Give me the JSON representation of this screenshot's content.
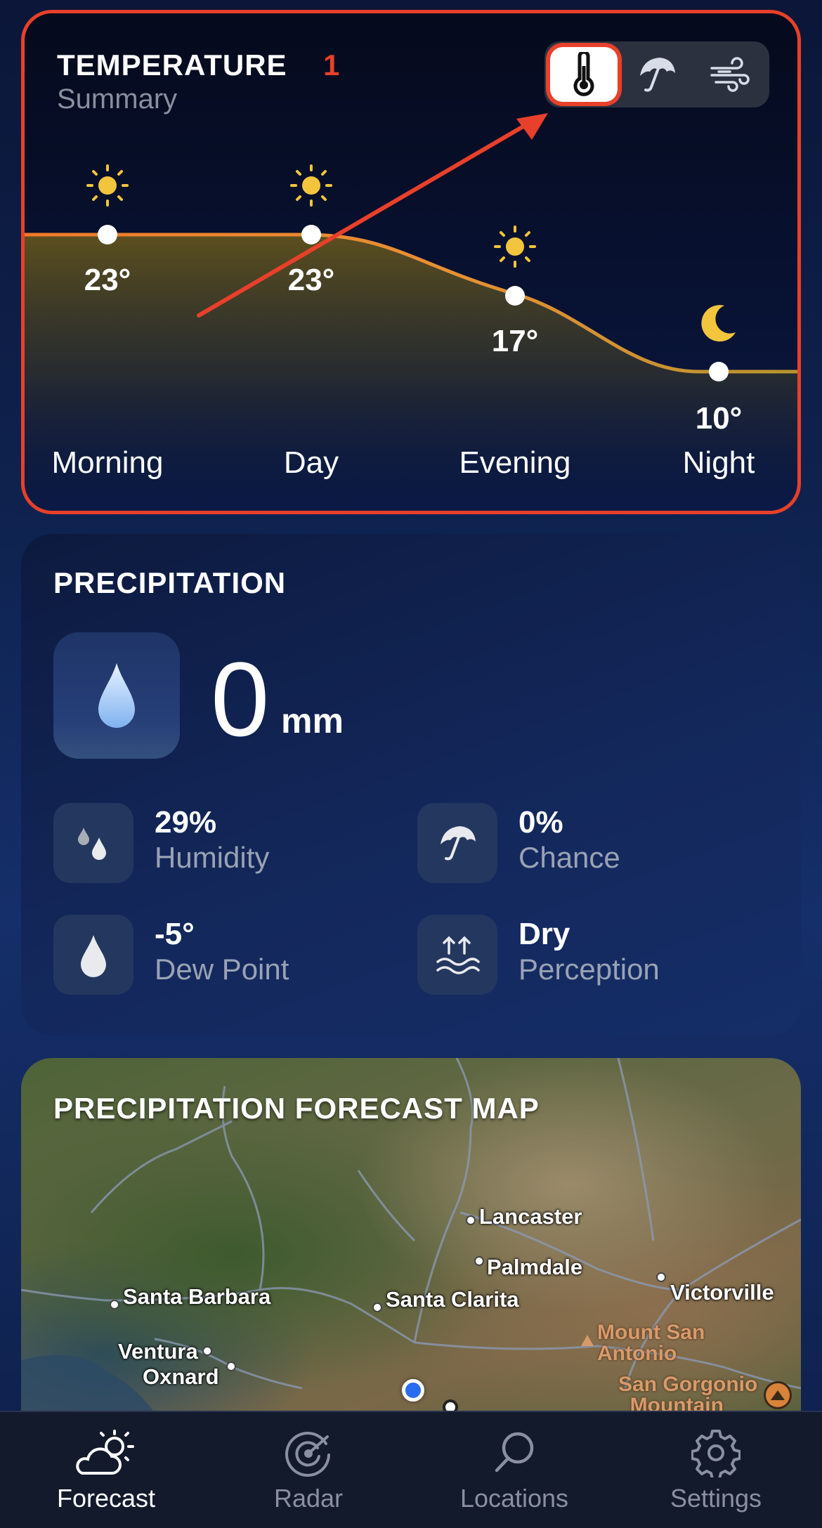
{
  "temperature_card": {
    "title": "TEMPERATURE",
    "badge": "1",
    "subtitle": "Summary",
    "toggles": [
      {
        "name": "temperature",
        "icon": "thermometer-icon",
        "selected": true
      },
      {
        "name": "precipitation",
        "icon": "umbrella-icon",
        "selected": false
      },
      {
        "name": "wind",
        "icon": "wind-icon",
        "selected": false
      }
    ],
    "periods": [
      {
        "label": "Morning",
        "temp": "23°",
        "icon": "sun-icon"
      },
      {
        "label": "Day",
        "temp": "23°",
        "icon": "sun-icon"
      },
      {
        "label": "Evening",
        "temp": "17°",
        "icon": "sun-icon"
      },
      {
        "label": "Night",
        "temp": "10°",
        "icon": "moon-icon"
      }
    ],
    "accent_color": "#e8402a"
  },
  "precipitation_card": {
    "title": "PRECIPITATION",
    "amount": "0",
    "unit": "mm",
    "stats": [
      {
        "value": "29%",
        "label": "Humidity",
        "icon": "droplets-icon"
      },
      {
        "value": "0%",
        "label": "Chance",
        "icon": "umbrella-icon"
      },
      {
        "value": "-5°",
        "label": "Dew Point",
        "icon": "droplet-icon"
      },
      {
        "value": "Dry",
        "label": "Perception",
        "icon": "waves-arrows-icon"
      }
    ]
  },
  "map_card": {
    "title": "PRECIPITATION FORECAST MAP",
    "cities": [
      "Lancaster",
      "Palmdale",
      "Santa Barbara",
      "Santa Clarita",
      "Victorville",
      "Ventura",
      "Oxnard"
    ],
    "mountains": [
      "Mount San\nAntonio",
      "San Gorgonio\nMountain"
    ]
  },
  "tab_bar": {
    "tabs": [
      {
        "label": "Forecast",
        "icon": "partly-cloudy-icon",
        "active": true
      },
      {
        "label": "Radar",
        "icon": "radar-icon",
        "active": false
      },
      {
        "label": "Locations",
        "icon": "search-icon",
        "active": false
      },
      {
        "label": "Settings",
        "icon": "gear-icon",
        "active": false
      }
    ]
  }
}
